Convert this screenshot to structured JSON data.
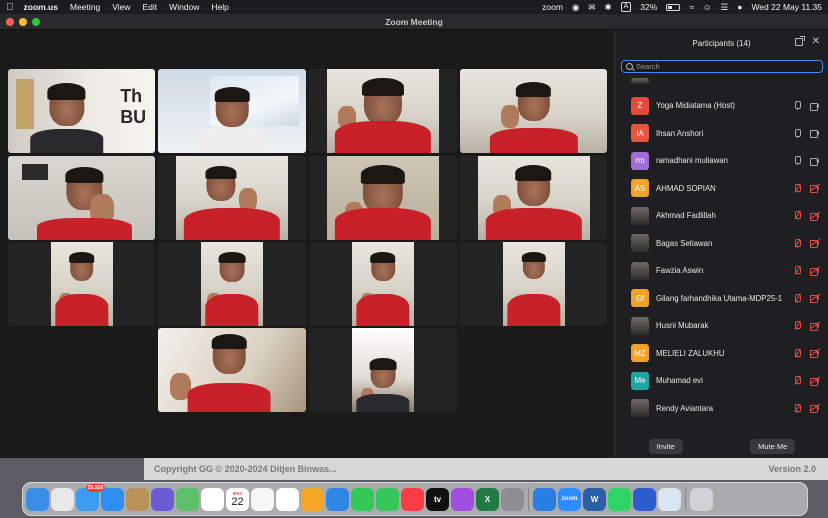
{
  "menubar": {
    "app_name": "zoom.us",
    "menus": [
      "Meeting",
      "View",
      "Edit",
      "Window",
      "Help"
    ],
    "zoom_indicator": "zoom",
    "input_source": "A",
    "battery": "32%",
    "datetime": "Wed 22 May  11.35"
  },
  "window": {
    "title": "Zoom Meeting"
  },
  "video_tiles": [
    {
      "id": "t1",
      "variant": "dark",
      "wall_text": "Th\nBU"
    },
    {
      "id": "t2",
      "variant": "white",
      "banner": true
    },
    {
      "id": "t3",
      "variant": "red"
    },
    {
      "id": "t4",
      "variant": "red"
    },
    {
      "id": "t5",
      "variant": "red",
      "active": true
    },
    {
      "id": "t6",
      "variant": "red"
    },
    {
      "id": "t7",
      "variant": "red"
    },
    {
      "id": "t8",
      "variant": "red"
    },
    {
      "id": "t9",
      "variant": "red"
    },
    {
      "id": "t10",
      "variant": "red"
    },
    {
      "id": "t11",
      "variant": "red"
    },
    {
      "id": "t12",
      "variant": "red"
    },
    {
      "id": "t13",
      "variant": "red"
    },
    {
      "id": "t14",
      "variant": "dark"
    }
  ],
  "participants": {
    "title": "Participants (14)",
    "search_placeholder": "Search",
    "invite_label": "Invite",
    "mute_all_label": "Mute Me",
    "list": [
      {
        "name": "Yoga Midiatama (Host)",
        "initials": "Z",
        "color": "#e84a3b",
        "mic_muted": false,
        "cam_muted": false
      },
      {
        "name": "Ihsan Anshori",
        "initials": "IA",
        "color": "#e8563f",
        "mic_muted": false,
        "cam_muted": false
      },
      {
        "name": "ramadhani muliawan",
        "initials": "rm",
        "color": "#a26cd6",
        "mic_muted": false,
        "cam_muted": false
      },
      {
        "name": "AHMAD SOPIAN",
        "initials": "AS",
        "color": "#f0a32a",
        "mic_muted": true,
        "cam_muted": true
      },
      {
        "name": "Akhmad Fadlillah",
        "initials": "",
        "photo": true,
        "mic_muted": true,
        "cam_muted": true
      },
      {
        "name": "Bagas Setiawan",
        "initials": "",
        "photo": true,
        "mic_muted": true,
        "cam_muted": true
      },
      {
        "name": "Fawzia Aswin",
        "initials": "",
        "photo": true,
        "mic_muted": true,
        "cam_muted": true
      },
      {
        "name": "Gilang farhandhika Utama-MDP25-1",
        "initials": "Gf",
        "color": "#f0a32a",
        "mic_muted": true,
        "cam_muted": true
      },
      {
        "name": "Husni Mubarak",
        "initials": "",
        "photo": true,
        "mic_muted": true,
        "cam_muted": true
      },
      {
        "name": "MELIELI ZALUKHU",
        "initials": "MZ",
        "color": "#f0a32a",
        "mic_muted": true,
        "cam_muted": true
      },
      {
        "name": "Muhamad evi",
        "initials": "Me",
        "color": "#1fa4a4",
        "mic_muted": true,
        "cam_muted": true
      },
      {
        "name": "Rendy Aviantara",
        "initials": "",
        "photo": true,
        "mic_muted": true,
        "cam_muted": true
      }
    ]
  },
  "background_page": {
    "copyright": "Copyright GG © 2020-2024 Ditjen Binwas...",
    "version": "Version 2.0"
  },
  "dock": {
    "calendar_month": "MAY",
    "calendar_day": "22",
    "mail_badge": "25.558",
    "apps": [
      {
        "name": "finder",
        "color": "#3a8ee6"
      },
      {
        "name": "launchpad",
        "color": "#e8e8e8"
      },
      {
        "name": "mail",
        "color": "#3b9cf2",
        "badge": true
      },
      {
        "name": "safari",
        "color": "#2f8ff0"
      },
      {
        "name": "contacts",
        "color": "#b9925b"
      },
      {
        "name": "siri",
        "color": "#6a5bd6"
      },
      {
        "name": "maps",
        "color": "#5fc06b"
      },
      {
        "name": "chrome",
        "color": "#ffffff"
      },
      {
        "name": "calendar",
        "color": "#ffffff",
        "calendar": true
      },
      {
        "name": "photos",
        "color": "#f6f6f6"
      },
      {
        "name": "reminders",
        "color": "#ffffff"
      },
      {
        "name": "pages",
        "color": "#f5a623"
      },
      {
        "name": "keynote",
        "color": "#2f86e6"
      },
      {
        "name": "messages",
        "color": "#36c759"
      },
      {
        "name": "facetime",
        "color": "#34c759"
      },
      {
        "name": "music",
        "color": "#fc3c44"
      },
      {
        "name": "apple-tv",
        "color": "#111111",
        "label": "tv"
      },
      {
        "name": "podcasts",
        "color": "#a14de0"
      },
      {
        "name": "excel",
        "color": "#1f7a43",
        "label": "X"
      },
      {
        "name": "system-settings",
        "color": "#8e8e93"
      },
      {
        "sep": true
      },
      {
        "name": "bluetooth-file-exchange",
        "color": "#2a7de1"
      },
      {
        "name": "zoom",
        "color": "#2d8cff",
        "label": "zoom"
      },
      {
        "name": "word",
        "color": "#2b5faa",
        "label": "W"
      },
      {
        "name": "whatsapp",
        "color": "#2fd366"
      },
      {
        "name": "stacks-app",
        "color": "#2d5ccf"
      },
      {
        "name": "preview",
        "color": "#d9e6f2"
      },
      {
        "sep": true
      },
      {
        "name": "trash",
        "color": "#cfd3d8"
      }
    ]
  }
}
